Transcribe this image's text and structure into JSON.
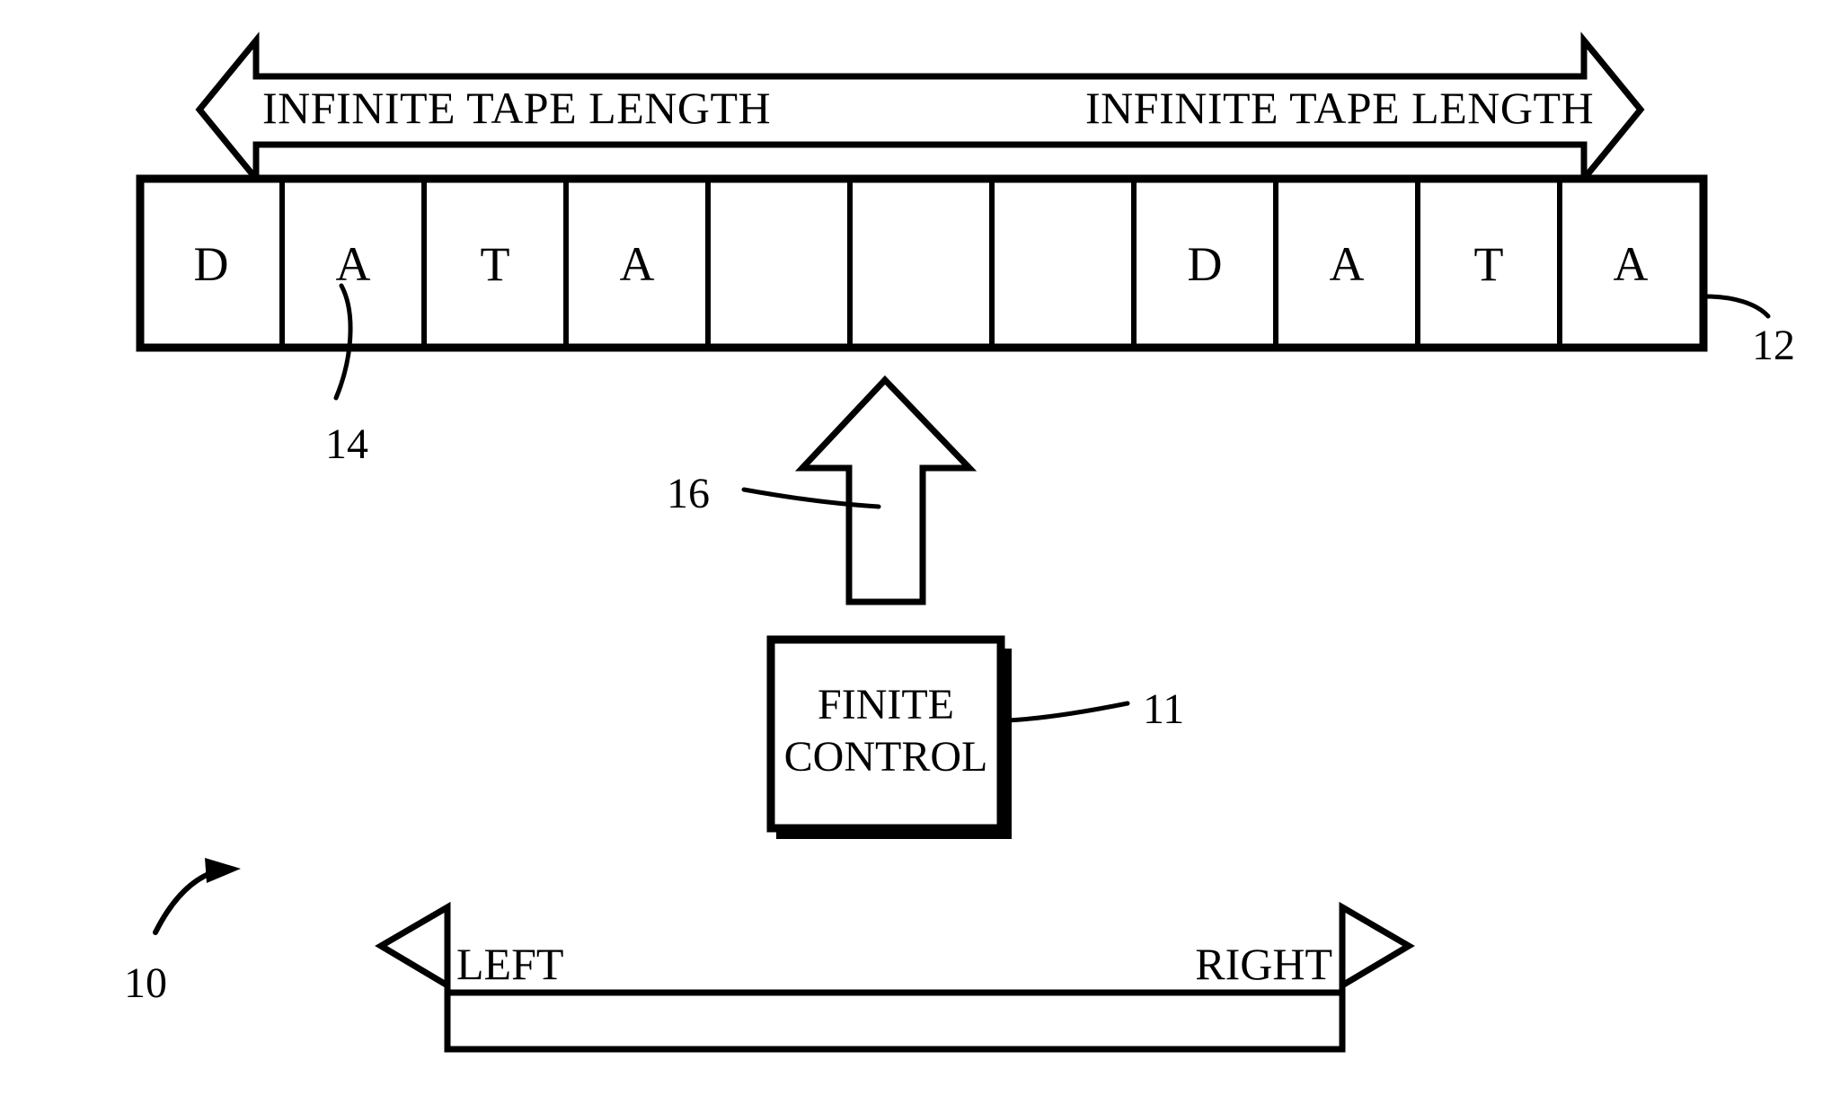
{
  "figure": {
    "reference_numeral": "10",
    "title_absent": true
  },
  "top_arrow": {
    "name": "infinite-tape-length-arrow",
    "direction": "bidirectional-horizontal",
    "left_label": "INFINITE TAPE LENGTH",
    "right_label": "INFINITE TAPE LENGTH"
  },
  "tape": {
    "reference_numeral": "12",
    "cell_reference_numeral": "14",
    "cells": [
      {
        "value": "D"
      },
      {
        "value": "A"
      },
      {
        "value": "T"
      },
      {
        "value": "A"
      },
      {
        "value": ""
      },
      {
        "value": ""
      },
      {
        "value": ""
      },
      {
        "value": "D"
      },
      {
        "value": "A"
      },
      {
        "value": "T"
      },
      {
        "value": "A"
      }
    ]
  },
  "head": {
    "name": "read-write-head-arrow",
    "reference_numeral": "16",
    "direction": "up"
  },
  "finite_control": {
    "line1": "FINITE",
    "line2": "CONTROL",
    "reference_numeral": "11"
  },
  "bottom_arrow": {
    "name": "movement-direction-arrow",
    "direction": "bidirectional-horizontal",
    "left_label": "LEFT",
    "right_label": "RIGHT"
  },
  "colors": {
    "ink": "#000000",
    "paper": "#ffffff"
  }
}
